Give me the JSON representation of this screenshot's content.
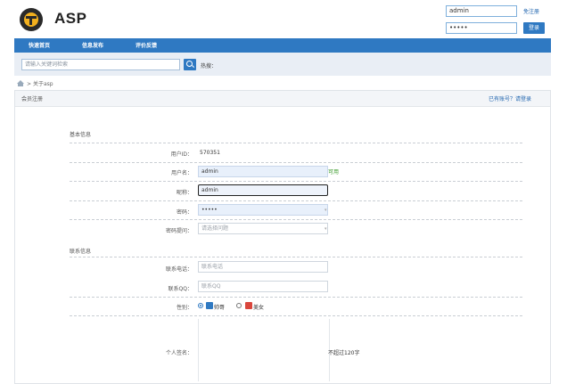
{
  "header": {
    "brand": "ASP",
    "username_value": "admin",
    "password_value": "•••••",
    "register_link": "免注册",
    "login_button": "登录"
  },
  "nav": {
    "items": [
      {
        "label": "快速首页"
      },
      {
        "label": "信息发布"
      },
      {
        "label": "评价反馈"
      }
    ]
  },
  "search": {
    "placeholder": "请输入关键词检索",
    "hot_label": "热搜："
  },
  "breadcrumb": {
    "current": "关于asp"
  },
  "panel": {
    "title": "会员注册",
    "top_link": "已有账号？请登录"
  },
  "form": {
    "section_basic": "基本信息",
    "section_contact": "联系信息",
    "id_label": "用户ID：",
    "id_value": "570351",
    "username_label": "用户名：",
    "username_value": "admin",
    "username_ok": "可用",
    "nickname_label": "昵称：",
    "nickname_value": "admin",
    "password_label": "密码：",
    "password_value": "•••••",
    "question_label": "密码提问：",
    "question_value": "请选择问题",
    "phone_label": "联系电话：",
    "phone_placeholder": "联系电话",
    "qq_label": "联系QQ：",
    "qq_placeholder": "联系QQ",
    "gender_label": "性别：",
    "gender_male": "帅哥",
    "gender_female": "美女",
    "signature_label": "个人签名：",
    "signature_hint": "不超过120字"
  },
  "colors": {
    "accent": "#2f79c2",
    "ok_green": "#3a9a2a"
  }
}
